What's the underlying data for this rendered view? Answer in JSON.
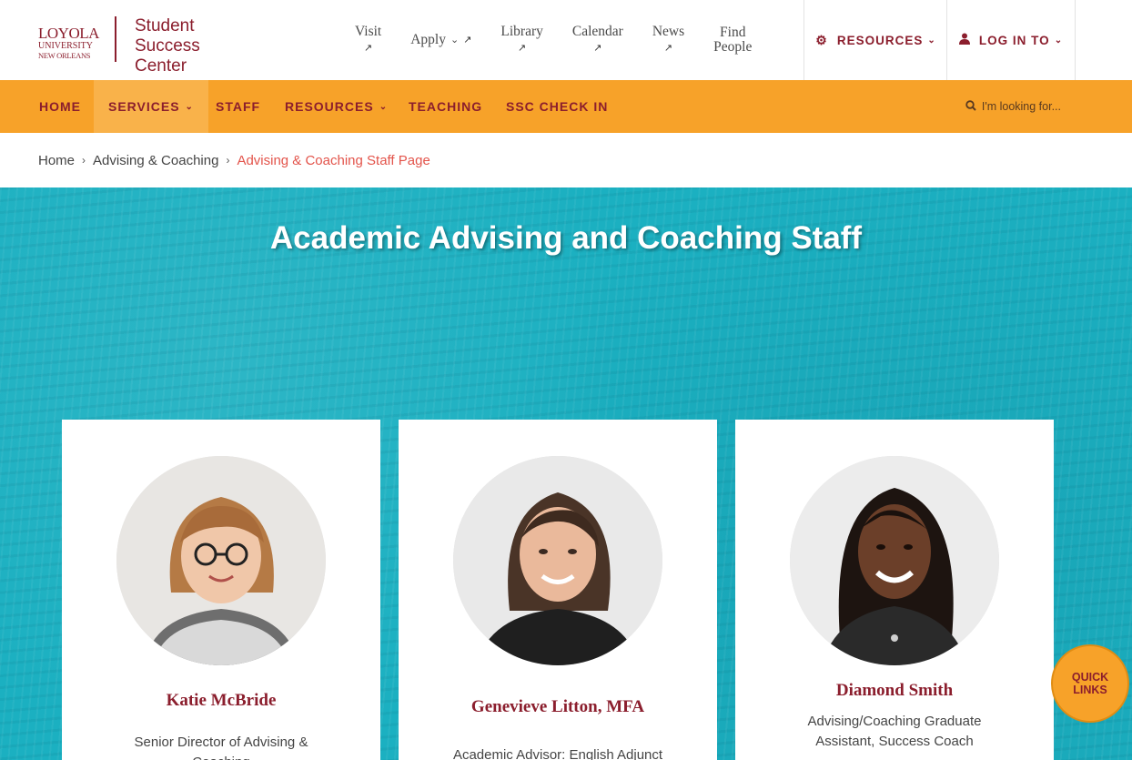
{
  "logo": {
    "line1": "LOYOLA",
    "line2": "UNIVERSITY",
    "line3": "NEW ORLEANS",
    "site_name": [
      "Student",
      "Success",
      "Center"
    ]
  },
  "top_links": [
    {
      "label": "Visit",
      "icon": "external-link-icon"
    },
    {
      "label": "Apply",
      "icon": "chevron-down-icon"
    },
    {
      "label": "Library",
      "icon": "external-link-icon"
    },
    {
      "label": "Calendar",
      "icon": "external-link-icon"
    },
    {
      "label": "News",
      "icon": "external-link-icon"
    },
    {
      "label": "Find People",
      "line1": "Find",
      "line2": "People"
    }
  ],
  "top_buttons": {
    "resources": {
      "label": "RESOURCES",
      "icon": "gear-icon"
    },
    "login": {
      "label": "LOG IN TO",
      "icon": "user-icon"
    }
  },
  "main_nav": [
    {
      "label": "HOME"
    },
    {
      "label": "SERVICES",
      "active": true
    },
    {
      "label": "STAFF"
    },
    {
      "label": "RESOURCES"
    },
    {
      "label": "TEACHING"
    },
    {
      "label": "SSC CHECK IN"
    }
  ],
  "search": {
    "placeholder": "I'm looking for..."
  },
  "breadcrumb": [
    "Home",
    "Advising & Coaching",
    "Advising & Coaching Staff Page"
  ],
  "hero": {
    "title": "Academic Advising and Coaching Staff"
  },
  "staff": [
    {
      "name": "Katie McBride",
      "title": "Senior Director of Advising & Coaching"
    },
    {
      "name": "Genevieve Litton, MFA",
      "title": "Academic Advisor: English Adjunct"
    },
    {
      "name": "Diamond Smith",
      "title": "Advising/Coaching Graduate Assistant, Success Coach"
    }
  ],
  "quick_links": {
    "line1": "QUICK",
    "line2": "LINKS"
  },
  "colors": {
    "maroon": "#8b1e2d",
    "orange": "#f7a229",
    "teal": "#1bb0c1",
    "crumb_active": "#e3544b"
  }
}
